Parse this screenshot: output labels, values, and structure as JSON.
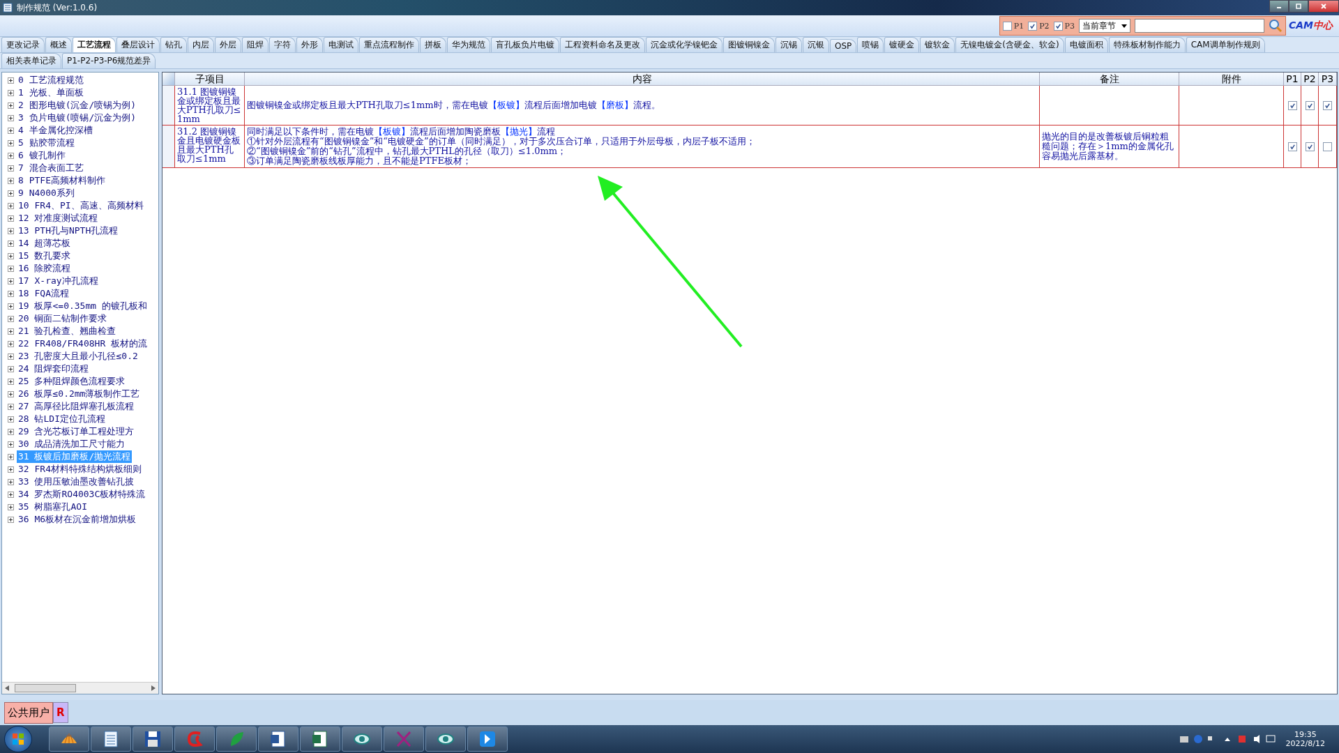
{
  "window": {
    "title": "制作规范 (Ver:1.0.6)"
  },
  "filter": {
    "options": [
      {
        "label": "P1",
        "checked": false
      },
      {
        "label": "P2",
        "checked": true
      },
      {
        "label": "P3",
        "checked": true
      }
    ],
    "scope": "当前章节"
  },
  "logo": {
    "latin": "CAM",
    "cjk": "中心"
  },
  "tab_rows": [
    [
      {
        "label": "更改记录",
        "selected": false
      },
      {
        "label": "概述",
        "selected": false
      },
      {
        "label": "工艺流程",
        "selected": true
      },
      {
        "label": "叠层设计",
        "selected": false
      },
      {
        "label": "钻孔",
        "selected": false
      },
      {
        "label": "内层",
        "selected": false
      },
      {
        "label": "外层",
        "selected": false
      },
      {
        "label": "阻焊",
        "selected": false
      },
      {
        "label": "字符",
        "selected": false
      },
      {
        "label": "外形",
        "selected": false
      },
      {
        "label": "电测试",
        "selected": false
      },
      {
        "label": "重点流程制作",
        "selected": false
      },
      {
        "label": "拼板",
        "selected": false
      },
      {
        "label": "华为规范",
        "selected": false
      },
      {
        "label": "盲孔板负片电镀",
        "selected": false
      },
      {
        "label": "工程资料命名及更改",
        "selected": false
      },
      {
        "label": "沉金或化学镍钯金",
        "selected": false
      },
      {
        "label": "图镀铜镍金",
        "selected": false
      },
      {
        "label": "沉锡",
        "selected": false
      },
      {
        "label": "沉银",
        "selected": false
      },
      {
        "label": "OSP",
        "selected": false
      },
      {
        "label": "喷锡",
        "selected": false
      },
      {
        "label": "镀硬金",
        "selected": false
      },
      {
        "label": "镀软金",
        "selected": false
      },
      {
        "label": "无镍电镀金(含硬金、软金)",
        "selected": false
      },
      {
        "label": "电镀面积",
        "selected": false
      },
      {
        "label": "特殊板材制作能力",
        "selected": false
      },
      {
        "label": "CAM调单制作规则",
        "selected": false
      }
    ],
    [
      {
        "label": "相关表单记录",
        "selected": false
      },
      {
        "label": "P1-P2-P3-P6规范差异",
        "selected": false
      }
    ]
  ],
  "tree": {
    "items": [
      {
        "label": "0 工艺流程规范",
        "selected": false,
        "expanded": false
      },
      {
        "label": "1 光板、单面板",
        "selected": false,
        "expanded": false
      },
      {
        "label": "2 图形电镀(沉金/喷锡为例)",
        "selected": false,
        "expanded": false
      },
      {
        "label": "3 负片电镀(喷锡/沉金为例)",
        "selected": false,
        "expanded": false
      },
      {
        "label": "4 半金属化控深槽",
        "selected": false,
        "expanded": false
      },
      {
        "label": "5 贴胶带流程",
        "selected": false,
        "expanded": false
      },
      {
        "label": "6 镀孔制作",
        "selected": false,
        "expanded": false
      },
      {
        "label": "7 混合表面工艺",
        "selected": false,
        "expanded": false
      },
      {
        "label": "8 PTFE高频材料制作",
        "selected": false,
        "expanded": false
      },
      {
        "label": "9 N4000系列",
        "selected": false,
        "expanded": false
      },
      {
        "label": "10 FR4、PI、高速、高频材料",
        "selected": false,
        "expanded": false
      },
      {
        "label": "12 对准度测试流程",
        "selected": false,
        "expanded": false
      },
      {
        "label": "13 PTH孔与NPTH孔流程",
        "selected": false,
        "expanded": false
      },
      {
        "label": "14 超薄芯板",
        "selected": false,
        "expanded": false
      },
      {
        "label": "15 数孔要求",
        "selected": false,
        "expanded": false
      },
      {
        "label": "16 除胶流程",
        "selected": false,
        "expanded": false
      },
      {
        "label": "17 X-ray冲孔流程",
        "selected": false,
        "expanded": false
      },
      {
        "label": "18 FQA流程",
        "selected": false,
        "expanded": false
      },
      {
        "label": "19 板厚<=0.35mm 的镀孔板和",
        "selected": false,
        "expanded": false
      },
      {
        "label": "20 铜面二钻制作要求",
        "selected": false,
        "expanded": false
      },
      {
        "label": "21 验孔检查、翘曲检查",
        "selected": false,
        "expanded": false
      },
      {
        "label": "22 FR408/FR408HR 板材的流",
        "selected": false,
        "expanded": false
      },
      {
        "label": "23 孔密度大且最小孔径≤0.2",
        "selected": false,
        "expanded": false
      },
      {
        "label": "24 阻焊套印流程",
        "selected": false,
        "expanded": false
      },
      {
        "label": "25 多种阻焊颜色流程要求",
        "selected": false,
        "expanded": false
      },
      {
        "label": "26 板厚≤0.2mm薄板制作工艺",
        "selected": false,
        "expanded": false
      },
      {
        "label": "27 高厚径比阻焊塞孔板流程",
        "selected": false,
        "expanded": false
      },
      {
        "label": "28 钻LDI定位孔流程",
        "selected": false,
        "expanded": false
      },
      {
        "label": "29 含光芯板订单工程处理方",
        "selected": false,
        "expanded": false
      },
      {
        "label": "30 成品清洗加工尺寸能力",
        "selected": false,
        "expanded": false
      },
      {
        "label": "31 板镀后加磨板/抛光流程",
        "selected": true,
        "expanded": false
      },
      {
        "label": "32 FR4材料特殊结构烘板细则",
        "selected": false,
        "expanded": false
      },
      {
        "label": "33 使用压敏油墨改善钻孔披",
        "selected": false,
        "expanded": false
      },
      {
        "label": "34 罗杰斯RO4003C板材特殊流",
        "selected": false,
        "expanded": false
      },
      {
        "label": "35 树脂塞孔AOI",
        "selected": false,
        "expanded": false
      },
      {
        "label": "36 M6板材在沉金前增加烘板",
        "selected": false,
        "expanded": false
      }
    ]
  },
  "table": {
    "columns": [
      "子项目",
      "内容",
      "备注",
      "附件",
      "P1",
      "P2",
      "P3"
    ],
    "rows": [
      {
        "sub_item": "31.1 图镀铜镍金或绑定板且最大PTH孔取刀≤1mm",
        "content": [
          "图镀铜镍金或绑定板且最大PTH孔取刀≤1mm时，需在电镀**【板镀】**流程后面增加电镀**【磨板】**流程。"
        ],
        "p": [
          true,
          true,
          true
        ]
      },
      {
        "sub_item": "31.2 图镀铜镍金且电镀硬金板且最大PTH孔取刀≤1mm",
        "content": [
          "同时满足以下条件时，需在电镀**【板镀】**流程后面增加陶瓷磨板**【抛光】**流程",
          "①针对外层流程有“图镀铜镍金”和“电镀硬金”的订单（同时满足），对于多次压合订单，只适用于外层母板，内层子板不适用；",
          "②“图镀铜镍金”前的“钻孔”流程中，钻孔最大PTHL的孔径（取刀）≤1.0mm；",
          "③订单满足陶瓷磨板线板厚能力，且不能是PTFE板材；"
        ],
        "remark": "抛光的目的是改善板镀后铜粒粗糙问题；存在＞1mm的金属化孔容易抛光后露基材。",
        "p": [
          true,
          true,
          false
        ]
      }
    ]
  },
  "status_bar": {
    "user": "公共用户",
    "role": "R"
  },
  "taskbar": {
    "time": "19:35",
    "date": "2022/8/12"
  }
}
